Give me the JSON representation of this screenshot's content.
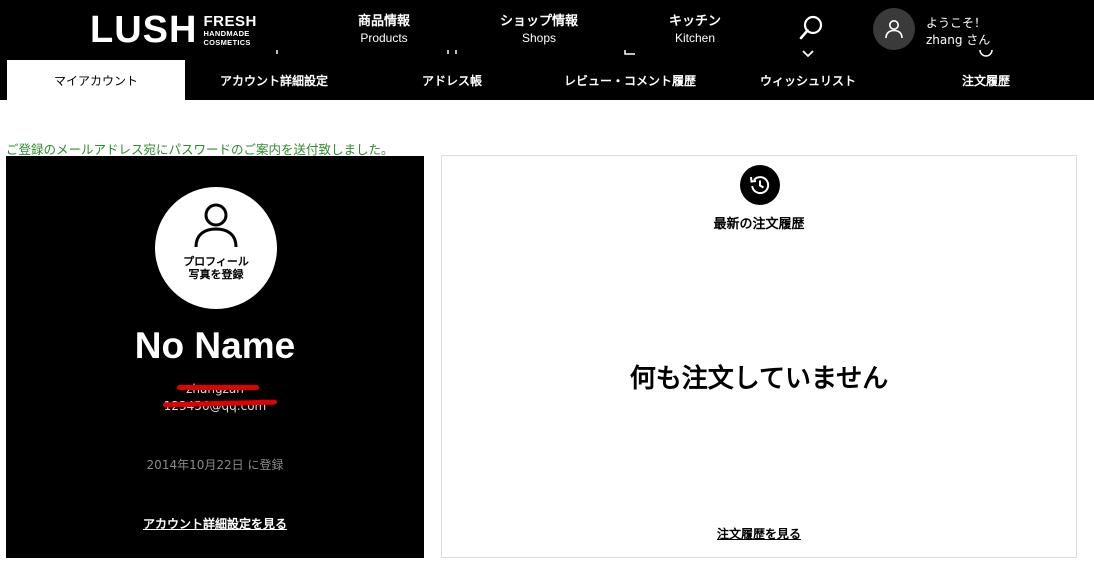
{
  "header": {
    "logo": {
      "word": "LUSH",
      "line1": "FRESH",
      "line2": "HANDMADE",
      "line3": "COSMETICS"
    },
    "nav": [
      {
        "ja": "商品情報",
        "en": "Products"
      },
      {
        "ja": "ショップ情報",
        "en": "Shops"
      },
      {
        "ja": "キッチン",
        "en": "Kitchen"
      }
    ],
    "search_icon": "search-icon",
    "user": {
      "greeting": "ようこそ！",
      "name": "zhang さん",
      "icon": "user-icon"
    }
  },
  "subnav": {
    "tabs": [
      {
        "label": "マイアカウント",
        "active": true
      },
      {
        "label": "アカウント詳細設定",
        "active": false
      },
      {
        "label": "アドレス帳",
        "active": false
      },
      {
        "label": "レビュー・コメント履歴",
        "active": false
      },
      {
        "label": "ウィッシュリスト",
        "active": false
      },
      {
        "label": "注文履歴",
        "active": false
      }
    ]
  },
  "notice": "ご登録のメールアドレス宛にパスワードのご案内を送付致しました。",
  "profile": {
    "photo_label_line1": "プロフィール",
    "photo_label_line2": "写真を登録",
    "name": "No Name",
    "username": "zhangzan",
    "email": "123456@qq.com",
    "member_since": "2014年10月22日 に登録",
    "account_link": "アカウント詳細設定を見る"
  },
  "orders": {
    "title": "最新の注文履歴",
    "empty_message": "何も注文していません",
    "link": "注文履歴を見る"
  },
  "colors": {
    "header_bg": "#000000",
    "notice_green": "#2e8b2e",
    "redaction_red": "#e00000",
    "muted_text": "#8a8a8a"
  }
}
